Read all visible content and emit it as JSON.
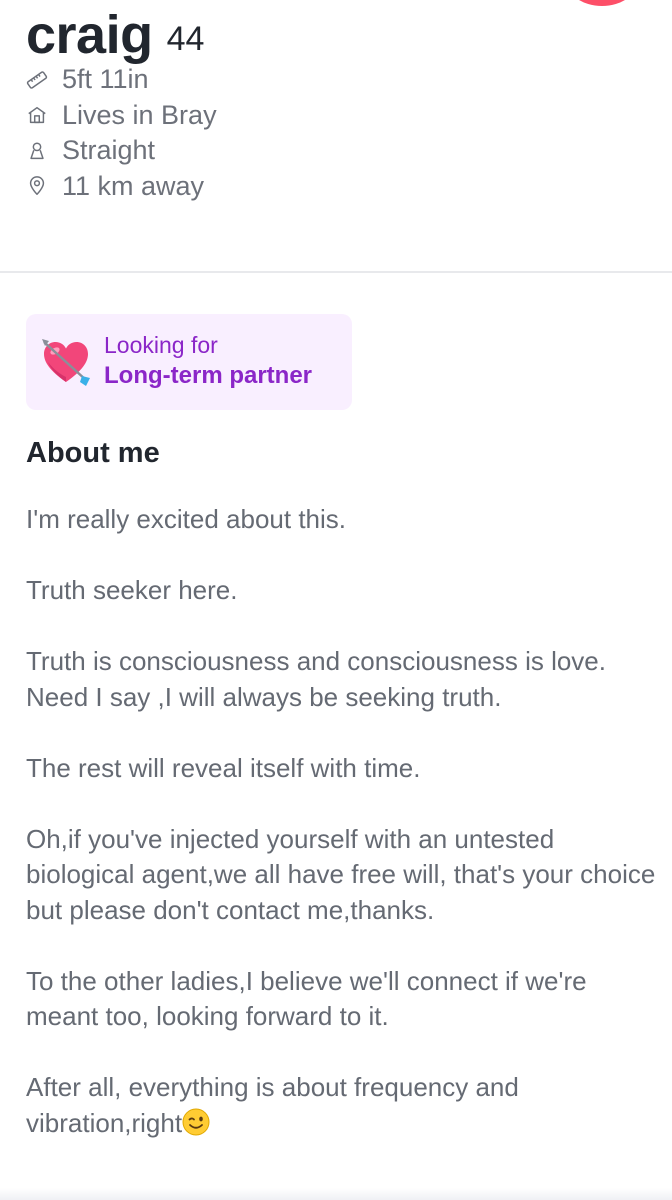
{
  "profile": {
    "name": "craig",
    "age": "44"
  },
  "facts": [
    {
      "icon": "ruler-icon",
      "text": "5ft 11in"
    },
    {
      "icon": "home-icon",
      "text": "Lives in Bray"
    },
    {
      "icon": "person-icon",
      "text": "Straight"
    },
    {
      "icon": "location-pin-icon",
      "text": "11 km away"
    }
  ],
  "looking_for": {
    "label": "Looking for",
    "value": "Long-term partner",
    "icon": "heart-with-arrow-icon"
  },
  "about": {
    "title": "About me",
    "paragraphs": [
      "I'm really excited about this.",
      "Truth seeker here.",
      "Truth is consciousness and consciousness is love.\nNeed I say ,I will always be seeking truth.",
      "The rest will reveal itself with time.",
      "Oh,if you've injected yourself with an untested biological agent,we all have free will, that's your choice but please don't contact me,thanks.",
      "To the other ladies,I believe we'll connect if we're meant too, looking forward to it.",
      "After all, everything is about frequency and vibration,right"
    ],
    "last_emoji": "winking-face-icon"
  },
  "colors": {
    "accent_purple": "#8b26c8",
    "card_bg": "#f9efff",
    "text_muted": "#656a73",
    "text_dark": "#21262e",
    "brand_red": "#fd4f68"
  }
}
